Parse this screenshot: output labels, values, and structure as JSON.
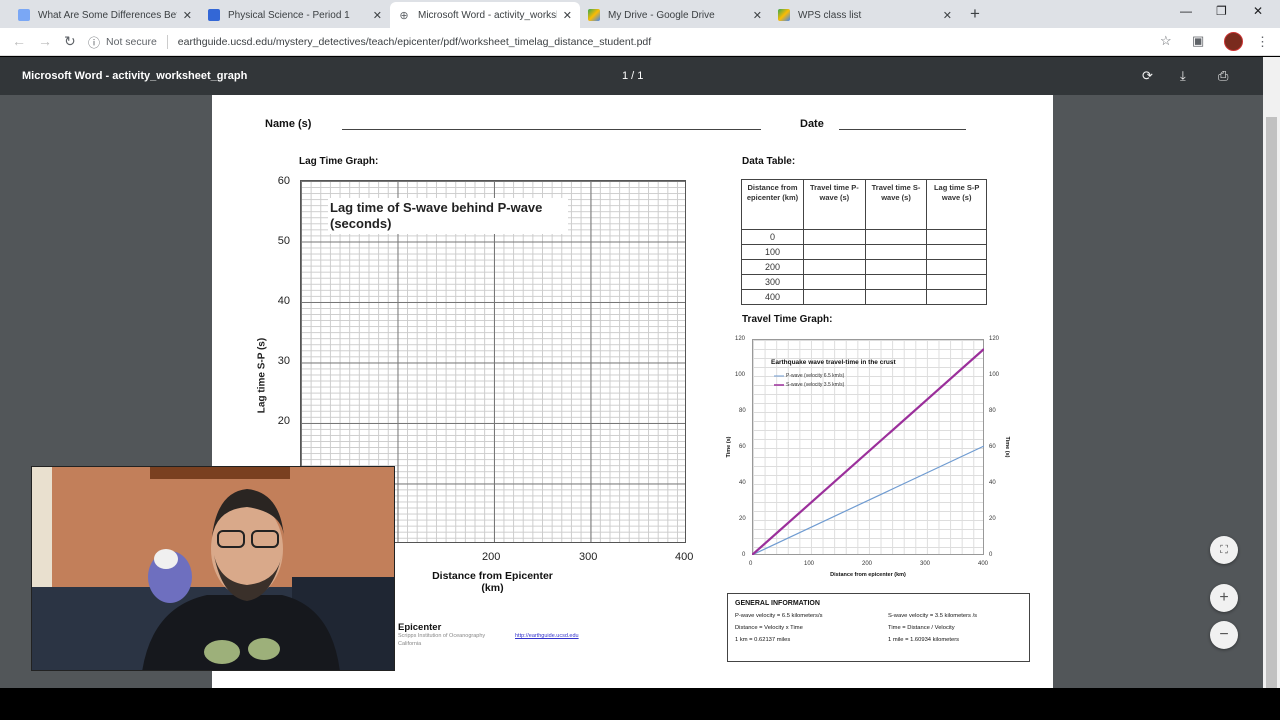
{
  "browser": {
    "tabs": [
      {
        "label": "What Are Some Differences Betw",
        "favicon_color": "#7aa7f5"
      },
      {
        "label": "Physical Science - Period 1",
        "favicon_color": "#3367d6"
      },
      {
        "label": "Microsoft Word - activity_workshe",
        "favicon_color": "#5f6368",
        "active": true
      },
      {
        "label": "My Drive - Google Drive",
        "favicon_color": "#34a853"
      },
      {
        "label": "WPS class list",
        "favicon_color": "#34a853"
      }
    ],
    "close_glyph": "✕",
    "new_tab": "+",
    "security_label": "Not secure",
    "url": "earthguide.ucsd.edu/mystery_detectives/teach/epicenter/pdf/worksheet_timelag_distance_student.pdf"
  },
  "pdf": {
    "title": "Microsoft Word - activity_worksheet_graph",
    "page_count": "1 / 1"
  },
  "worksheet": {
    "name_label": "Name (s)",
    "date_label": "Date",
    "lag_graph_label": "Lag Time Graph:",
    "lag_graph_title": "Lag time of S-wave behind P-wave (seconds)",
    "lag_y_label": "Lag time S-P (s)",
    "lag_x_label": "Distance from Epicenter (km)",
    "lag_y_ticks": [
      "60",
      "50",
      "40",
      "30",
      "20"
    ],
    "lag_x_ticks": [
      "200",
      "300",
      "400"
    ],
    "data_table_label": "Data Table:",
    "table_headers": [
      "Distance from epicenter (km)",
      "Travel time P-wave (s)",
      "Travel time S-wave (s)",
      "Lag time S-P wave (s)"
    ],
    "table_rows": [
      "0",
      "100",
      "200",
      "300",
      "400"
    ],
    "travel_graph_label": "Travel Time Graph:",
    "footer_title": "Epicenter",
    "footer_credit": "Scripps Institution of Oceanography",
    "footer_link": "http://earthguide.ucsd.edu",
    "footer_place": "California"
  },
  "travel_graph": {
    "title": "Earthquake wave travel-time in the crust",
    "legend_p": "P-wave (velocity 6.5 km/s)",
    "legend_s": "S-wave (velocity 3.5 km/s)",
    "x_label": "Distance from epicenter (km)",
    "y_label": "Time (s)",
    "y_ticks": [
      "0",
      "20",
      "40",
      "60",
      "80",
      "100",
      "120"
    ],
    "x_ticks": [
      "0",
      "100",
      "200",
      "300",
      "400"
    ],
    "color_p": "#6f9bd1",
    "color_s": "#9b2f9b"
  },
  "general_info": {
    "heading": "GENERAL INFORMATION",
    "p_velocity": "P-wave velocity = 6.5 kilometers/s",
    "s_velocity": "S-wave velocity = 3.5 kilometers /s",
    "dist_formula": "Distance = Velocity x Time",
    "time_formula": "Time = Distance / Velocity",
    "km_miles": "1 km = 0.62137 miles",
    "mile_km": "1 mile = 1.60934 kilometers"
  }
}
